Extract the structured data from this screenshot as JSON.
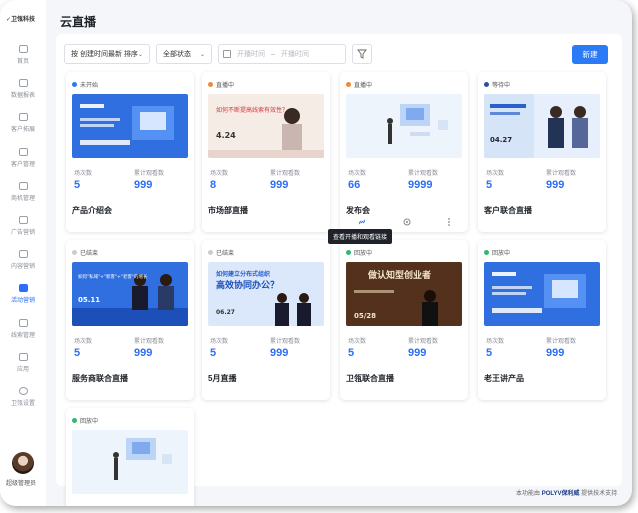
{
  "sidebar": {
    "brand": "✓卫瓴科技",
    "items": [
      {
        "label": "首页",
        "active": false
      },
      {
        "label": "数据报表",
        "active": false
      },
      {
        "label": "客户拓展",
        "active": false
      },
      {
        "label": "客户管理",
        "active": false
      },
      {
        "label": "商机管理",
        "active": false
      },
      {
        "label": "广告营销",
        "active": false
      },
      {
        "label": "内容营销",
        "active": false
      },
      {
        "label": "活动营销",
        "active": true
      },
      {
        "label": "线索管理",
        "active": false
      },
      {
        "label": "应用",
        "active": false
      },
      {
        "label": "卫瓴设置",
        "active": false
      }
    ],
    "admin_label": "超级管理员"
  },
  "header": {
    "title": "云直播"
  },
  "toolbar": {
    "sort_value": "按 创建时间最新 排序",
    "status_value": "全部状态",
    "date_start_placeholder": "开播时间",
    "date_end_placeholder": "开播时间",
    "new_label": "新建"
  },
  "stat_labels": {
    "sessions": "场次数",
    "views": "累计观看数"
  },
  "cards": [
    {
      "status": "未开始",
      "status_color": "#2b7bf6",
      "sessions": "5",
      "views": "999",
      "name": "产品介绍会",
      "thumb": "product"
    },
    {
      "status": "直播中",
      "status_color": "#f0883a",
      "sessions": "8",
      "views": "999",
      "name": "市场部直播",
      "thumb": "market"
    },
    {
      "status": "直播中",
      "status_color": "#f0883a",
      "sessions": "66",
      "views": "9999",
      "name": "发布会",
      "thumb": "launch"
    },
    {
      "status": "等待中",
      "status_color": "#2d4ea8",
      "sessions": "5",
      "views": "999",
      "name": "客户联合直播",
      "thumb": "customer"
    },
    {
      "status": "已结束",
      "status_color": "#c8ccd4",
      "sessions": "5",
      "views": "999",
      "name": "服务商联合直播",
      "thumb": "partner"
    },
    {
      "status": "已结束",
      "status_color": "#c8ccd4",
      "sessions": "5",
      "views": "999",
      "name": "5月直播",
      "thumb": "may"
    },
    {
      "status": "回放中",
      "status_color": "#2fb86a",
      "sessions": "5",
      "views": "999",
      "name": "卫瓴联合直播",
      "thumb": "joint"
    },
    {
      "status": "回放中",
      "status_color": "#2fb86a",
      "sessions": "5",
      "views": "999",
      "name": "老王讲产品",
      "thumb": "wang"
    },
    {
      "status": "回放中",
      "status_color": "#2fb86a",
      "sessions": "",
      "views": "",
      "name": "",
      "thumb": "blank"
    }
  ],
  "thumb_text": {
    "market_headline": "如何不断提高线索有效性？",
    "market_date": "4.24",
    "customer_date": "04.27",
    "partner_headline": "如何\"私域\"+\"新客\"+\"老客\"的增长",
    "partner_date": "05.11",
    "may_headline": "如何建立分布式组织",
    "may_headline2": "高效协同办公？",
    "may_date": "06.27",
    "joint_headline": "做认知型创业者",
    "joint_date": "05/28"
  },
  "hover_tooltip": "查看开播和观看链接",
  "footer": {
    "prefix": "本功能由",
    "brand": "POLYV保利威",
    "suffix": "提供技术支持"
  }
}
